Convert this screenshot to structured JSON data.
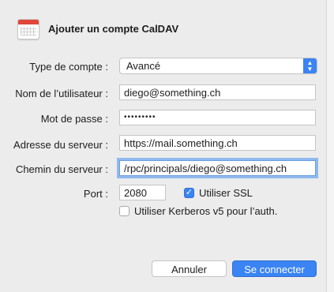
{
  "header": {
    "icon": "calendar-icon",
    "title": "Ajouter un compte CalDAV"
  },
  "form": {
    "account_type": {
      "label": "Type de compte :",
      "value": "Avancé"
    },
    "username": {
      "label": "Nom de l’utilisateur :",
      "value": "diego@something.ch"
    },
    "password": {
      "label": "Mot de passe :",
      "value": "•••••••••"
    },
    "server_address": {
      "label": "Adresse du serveur :",
      "value": "https://mail.something.ch"
    },
    "server_path": {
      "label": "Chemin du serveur :",
      "value": "/rpc/principals/diego@something.ch"
    },
    "port": {
      "label": "Port :",
      "value": "2080"
    },
    "use_ssl": {
      "label": "Utiliser SSL",
      "checked": true
    },
    "use_kerberos": {
      "label": "Utiliser Kerberos v5 pour l’auth.",
      "checked": false
    }
  },
  "buttons": {
    "cancel": "Annuler",
    "connect": "Se connecter"
  },
  "colors": {
    "accent": "#3a84f4",
    "focus_ring": "#8fb8ef"
  }
}
